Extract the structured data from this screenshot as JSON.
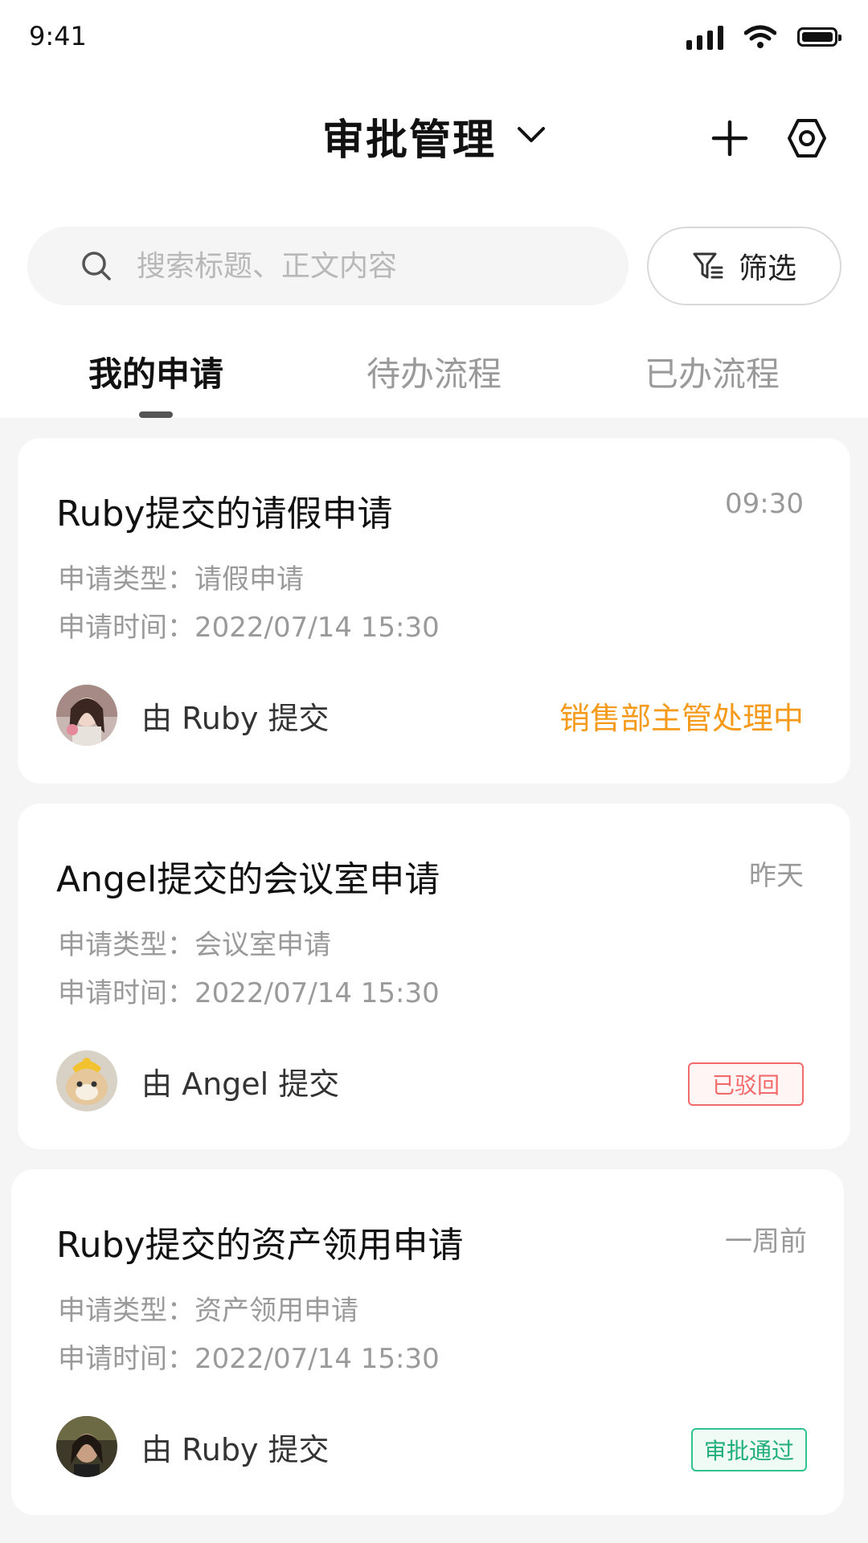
{
  "status_bar": {
    "time": "9:41"
  },
  "header": {
    "title": "审批管理"
  },
  "search": {
    "placeholder": "搜索标题、正文内容",
    "value": ""
  },
  "filter": {
    "label": "筛选"
  },
  "tabs": [
    {
      "label": "我的申请",
      "active": true
    },
    {
      "label": "待办流程",
      "active": false
    },
    {
      "label": "已办流程",
      "active": false
    }
  ],
  "cards": [
    {
      "title": "Ruby提交的请假申请",
      "time": "09:30",
      "type_label": "申请类型：",
      "type_value": "请假申请",
      "date_label": "申请时间：",
      "date_value": "2022/07/14 15:30",
      "submitter": "由 Ruby 提交",
      "status": "销售部主管处理中",
      "status_kind": "text",
      "status_color": "#f59a1a"
    },
    {
      "title": "Angel提交的会议室申请",
      "time": "昨天",
      "type_label": "申请类型：",
      "type_value": "会议室申请",
      "date_label": "申请时间：",
      "date_value": "2022/07/14 15:30",
      "submitter": "由 Angel 提交",
      "status": "已驳回",
      "status_kind": "badge",
      "status_color": "#f26b6b"
    },
    {
      "title": "Ruby提交的资产领用申请",
      "time": "一周前",
      "type_label": "申请类型：",
      "type_value": "资产领用申请",
      "date_label": "申请时间：",
      "date_value": "2022/07/14 15:30",
      "submitter": "由 Ruby 提交",
      "status": "审批通过",
      "status_kind": "badge",
      "status_color": "#1fae7c"
    }
  ],
  "icons": {
    "title": "chevron-down-icon",
    "add": "plus-icon",
    "settings": "gear-icon",
    "search": "search-icon",
    "filter": "filter-icon"
  }
}
